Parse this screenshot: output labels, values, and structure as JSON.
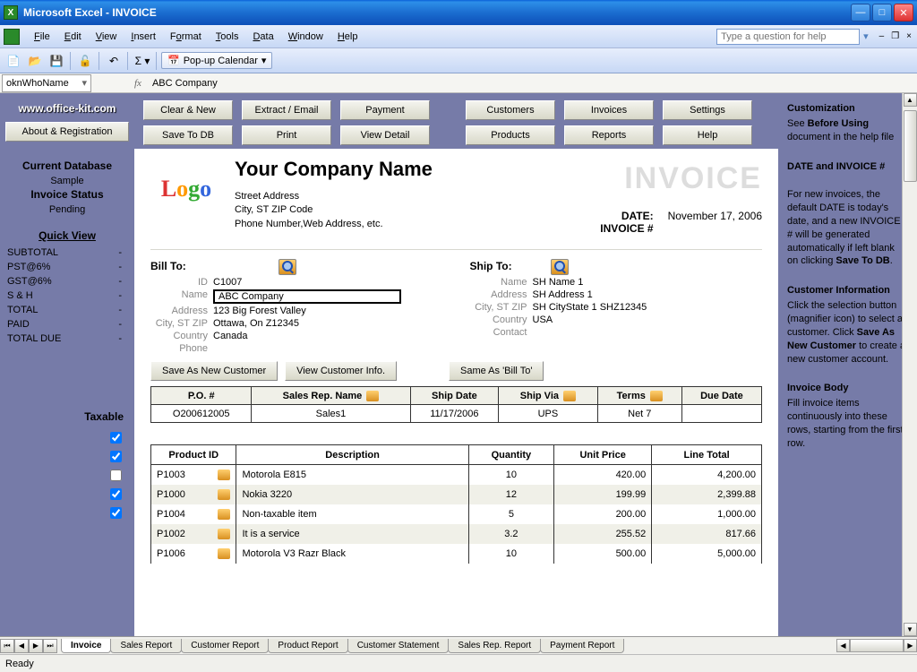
{
  "titlebar": {
    "text": "Microsoft Excel - INVOICE"
  },
  "menubar": {
    "items": [
      "File",
      "Edit",
      "View",
      "Insert",
      "Format",
      "Tools",
      "Data",
      "Window",
      "Help"
    ],
    "help_placeholder": "Type a question for help"
  },
  "toolbar": {
    "popup_calendar": "Pop-up Calendar"
  },
  "formula_bar": {
    "name_box": "oknWhoName",
    "formula": "ABC Company"
  },
  "left_panel": {
    "website": "www.office-kit.com",
    "about_btn": "About & Registration",
    "db_heading": "Current Database",
    "db_name": "Sample",
    "status_heading": "Invoice Status",
    "status_value": "Pending",
    "quick_view": "Quick View",
    "rows": [
      {
        "label": "SUBTOTAL",
        "val": "-"
      },
      {
        "label": "PST@6%",
        "val": "-"
      },
      {
        "label": "GST@6%",
        "val": "-"
      },
      {
        "label": "S & H",
        "val": "-"
      },
      {
        "label": "TOTAL",
        "val": "-"
      },
      {
        "label": "PAID",
        "val": "-"
      },
      {
        "label": "TOTAL DUE",
        "val": "-"
      }
    ],
    "taxable_label": "Taxable"
  },
  "buttons": {
    "row1": [
      "Clear & New",
      "Extract / Email",
      "Payment"
    ],
    "row2": [
      "Save To DB",
      "Print",
      "View Detail"
    ],
    "col2_row1": [
      "Customers",
      "Invoices",
      "Settings"
    ],
    "col2_row2": [
      "Products",
      "Reports",
      "Help"
    ]
  },
  "invoice": {
    "company_name": "Your Company Name",
    "street": "Street Address",
    "city_st_zip": "City, ST  ZIP Code",
    "phone_web": "Phone Number,Web Address, etc.",
    "invoice_word": "INVOICE",
    "date_label": "DATE:",
    "date_value": "November 17, 2006",
    "invnum_label": "INVOICE #",
    "bill_to_label": "Bill To:",
    "ship_to_label": "Ship To:",
    "field_labels": {
      "id": "ID",
      "name": "Name",
      "address": "Address",
      "citystzip": "City, ST ZIP",
      "country": "Country",
      "phone": "Phone",
      "contact": "Contact"
    },
    "bill": {
      "id": "C1007",
      "name": "ABC Company",
      "address": "123 Big Forest Valley",
      "citystzip": "Ottawa, On Z12345",
      "country": "Canada",
      "phone": ""
    },
    "ship": {
      "name": "SH Name 1",
      "address": "SH Address 1",
      "citystzip": "SH CityState 1 SHZ12345",
      "country": "USA",
      "contact": ""
    },
    "cust_btns": {
      "save_new": "Save As New Customer",
      "view_info": "View Customer Info.",
      "same_as": "Same As 'Bill To'"
    },
    "info_headers": [
      "P.O. #",
      "Sales Rep. Name",
      "Ship Date",
      "Ship Via",
      "Terms",
      "Due Date"
    ],
    "info_values": [
      "O200612005",
      "Sales1",
      "11/17/2006",
      "UPS",
      "Net 7",
      ""
    ],
    "line_headers": [
      "Product ID",
      "Description",
      "Quantity",
      "Unit Price",
      "Line Total"
    ],
    "lines": [
      {
        "taxable": true,
        "pid": "P1003",
        "desc": "Motorola E815",
        "qty": "10",
        "price": "420.00",
        "total": "4,200.00"
      },
      {
        "taxable": true,
        "pid": "P1000",
        "desc": "Nokia 3220",
        "qty": "12",
        "price": "199.99",
        "total": "2,399.88"
      },
      {
        "taxable": false,
        "pid": "P1004",
        "desc": "Non-taxable  item",
        "qty": "5",
        "price": "200.00",
        "total": "1,000.00"
      },
      {
        "taxable": true,
        "pid": "P1002",
        "desc": "It is a service",
        "qty": "3.2",
        "price": "255.52",
        "total": "817.66"
      },
      {
        "taxable": true,
        "pid": "P1006",
        "desc": "Motorola V3 Razr Black",
        "qty": "10",
        "price": "500.00",
        "total": "5,000.00"
      }
    ]
  },
  "right_panel": {
    "customization_head": "Customization",
    "customization_body_pre": "See ",
    "customization_body_bold": "Before Using",
    "customization_body_post": " document in the help file",
    "date_head": "DATE and INVOICE #",
    "date_body_pre": "For new invoices, the default DATE is today's date, and a new INVOICE # will be generated automatically if left blank on clicking ",
    "date_body_bold": "Save To DB",
    "custinfo_head": "Customer Information",
    "custinfo_pre": "Click the selection button (magnifier icon) to select a customer. Click ",
    "custinfo_bold": "Save As New Customer",
    "custinfo_post": " to create a new customer account.",
    "body_head": "Invoice Body",
    "body_text": "Fill invoice items continuously into these rows, starting from the first row."
  },
  "tabs": [
    "Invoice",
    "Sales Report",
    "Customer Report",
    "Product Report",
    "Customer Statement",
    "Sales Rep. Report",
    "Payment Report"
  ],
  "status": {
    "ready": "Ready"
  }
}
